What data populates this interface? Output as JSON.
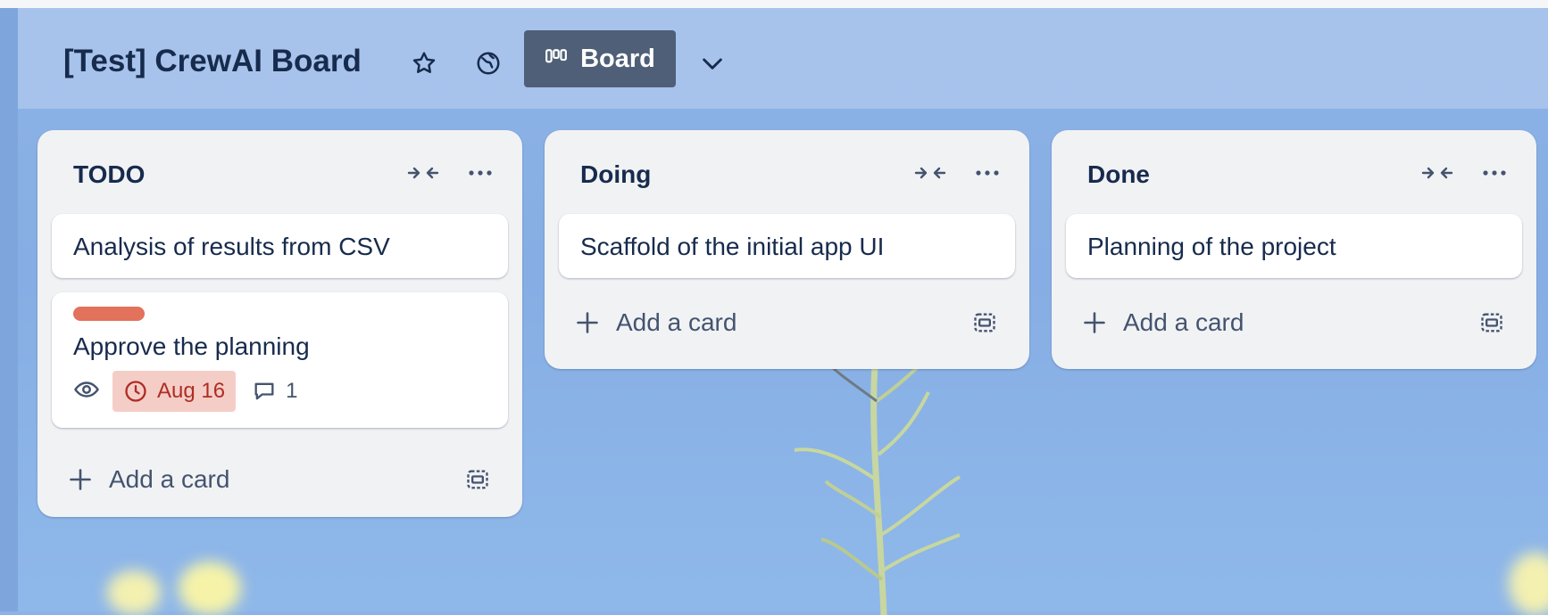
{
  "header": {
    "title": "[Test] CrewAI Board",
    "view_label": "Board",
    "icons": {
      "star": "star-icon",
      "visibility": "globe-icon",
      "board": "board-columns-icon",
      "dropdown": "chevron-down-icon"
    }
  },
  "colors": {
    "header_bg": "#abc5ec",
    "board_btn": "#4f5f77",
    "list_bg": "#f1f2f4",
    "label_red": "#e2725b",
    "due_bg": "#f5cdc7",
    "due_text": "#ae2e24",
    "text_primary": "#172b4d"
  },
  "lists": [
    {
      "title": "TODO",
      "cards": [
        {
          "title": "Analysis of results from CSV"
        },
        {
          "title": "Approve the planning",
          "label_color": "#e2725b",
          "due": "Aug 16",
          "comments": "1",
          "watching": true
        }
      ],
      "add_label": "Add a card"
    },
    {
      "title": "Doing",
      "cards": [
        {
          "title": "Scaffold of the initial app UI"
        }
      ],
      "add_label": "Add a card"
    },
    {
      "title": "Done",
      "cards": [
        {
          "title": "Planning of the project"
        }
      ],
      "add_label": "Add a card"
    }
  ]
}
